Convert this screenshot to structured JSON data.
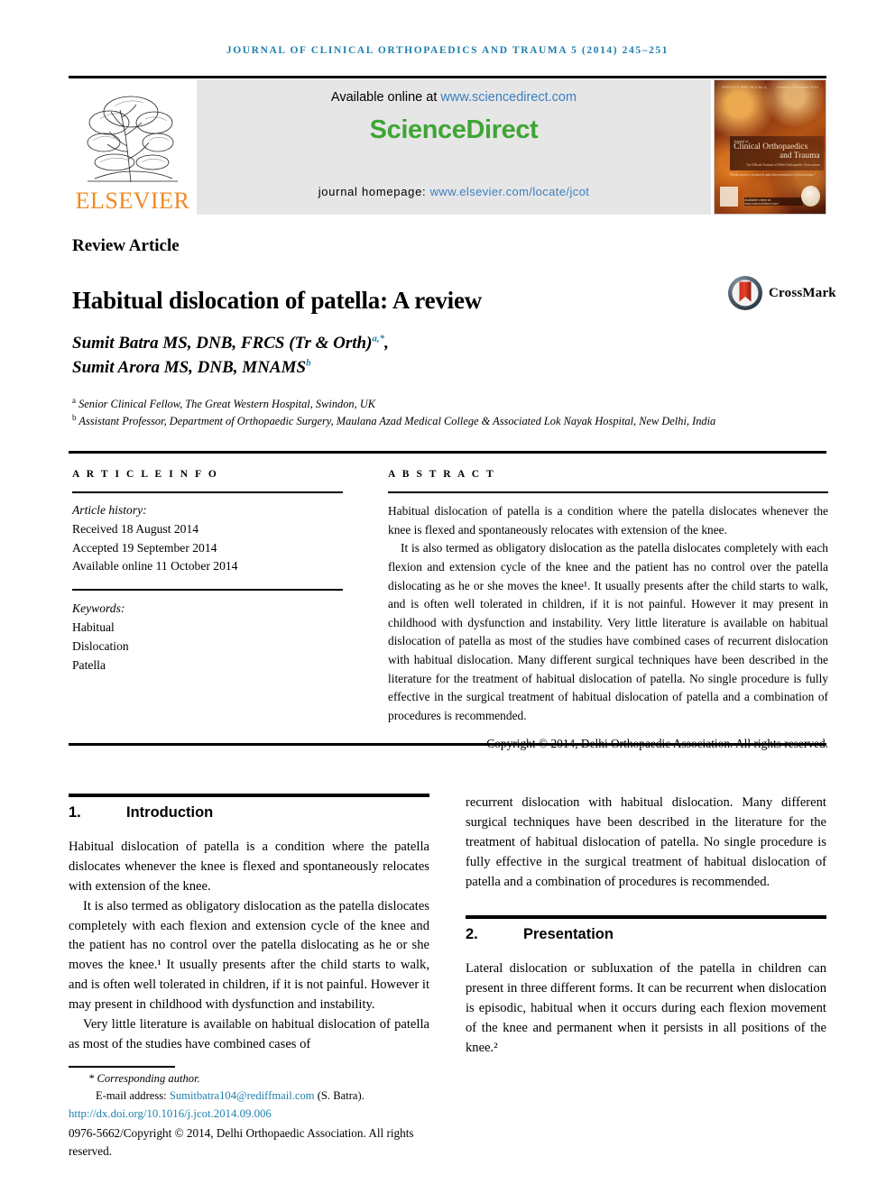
{
  "running_head": "JOURNAL OF CLINICAL ORTHOPAEDICS AND TRAUMA 5 (2014) 245–251",
  "masthead": {
    "publisher_name": "ELSEVIER",
    "available_prefix": "Available online at ",
    "available_url": "www.sciencedirect.com",
    "sciencedirect_science": "Science",
    "sciencedirect_direct": "Direct",
    "homepage_prefix": "journal homepage: ",
    "homepage_url": "www.elsevier.com/locate/jcot",
    "cover": {
      "top_left": "ISSN 0976-5662  Vol 5 No 4",
      "top_right": "October - December 2014",
      "kicker": "Journal of",
      "title_line1": "Clinical Orthopaedics",
      "title_line2": "and Trauma",
      "subtitle": "An Official Journal of Delhi Orthopaedic Association",
      "quote": "“Dedicated to research and dissemination of knowledge”",
      "bottom_bar": "Available online at www.sciencedirect.com"
    }
  },
  "article": {
    "type_label": "Review Article",
    "title": "Habitual dislocation of patella: A review",
    "crossmark_label": "CrossMark",
    "authors": [
      {
        "name": "Sumit Batra MS, DNB, FRCS (Tr & Orth)",
        "marks": "a,*",
        "trailing": ","
      },
      {
        "name": "Sumit Arora MS, DNB, MNAMS",
        "marks": "b",
        "trailing": ""
      }
    ],
    "affiliations": [
      {
        "mark": "a",
        "text": "Senior Clinical Fellow, The Great Western Hospital, Swindon, UK"
      },
      {
        "mark": "b",
        "text": "Assistant Professor, Department of Orthopaedic Surgery, Maulana Azad Medical College & Associated Lok Nayak Hospital, New Delhi, India"
      }
    ]
  },
  "article_info": {
    "label": "A R T I C L E  I N F O",
    "history_header": "Article history:",
    "received": "Received 18 August 2014",
    "accepted": "Accepted 19 September 2014",
    "available_online": "Available online 11 October 2014",
    "keywords_header": "Keywords:",
    "keywords": [
      "Habitual",
      "Dislocation",
      "Patella"
    ]
  },
  "abstract": {
    "label": "A B S T R A C T",
    "paragraphs": [
      "Habitual dislocation of patella is a condition where the patella dislocates whenever the knee is flexed and spontaneously relocates with extension of the knee.",
      "It is also termed as obligatory dislocation as the patella dislocates completely with each flexion and extension cycle of the knee and the patient has no control over the patella dislocating as he or she moves the knee¹. It usually presents after the child starts to walk, and is often well tolerated in children, if it is not painful. However it may present in childhood with dysfunction and instability. Very little literature is available on habitual dislocation of patella as most of the studies have combined cases of recurrent dislocation with habitual dislocation. Many different surgical techniques have been described in the literature for the treatment of habitual dislocation of patella. No single procedure is fully effective in the surgical treatment of habitual dislocation of patella and a combination of procedures is recommended."
    ],
    "copyright": "Copyright © 2014, Delhi Orthopaedic Association. All rights reserved."
  },
  "sections": [
    {
      "number": "1.",
      "title": "Introduction",
      "paragraphs": [
        "Habitual dislocation of patella is a condition where the patella dislocates whenever the knee is flexed and spontaneously relocates with extension of the knee.",
        "It is also termed as obligatory dislocation as the patella dislocates completely with each flexion and extension cycle of the knee and the patient has no control over the patella dislocating as he or she moves the knee.¹ It usually presents after the child starts to walk, and is often well tolerated in children, if it is not painful. However it may present in childhood with dysfunction and instability.",
        "Very little literature is available on habitual dislocation of patella as most of the studies have combined cases of",
        "recurrent dislocation with habitual dislocation. Many different surgical techniques have been described in the literature for the treatment of habitual dislocation of patella. No single procedure is fully effective in the surgical treatment of habitual dislocation of patella and a combination of procedures is recommended."
      ]
    },
    {
      "number": "2.",
      "title": "Presentation",
      "paragraphs": [
        "Lateral dislocation or subluxation of the patella in children can present in three different forms. It can be recurrent when dislocation is episodic, habitual when it occurs during each flexion movement of the knee and permanent when it persists in all positions of the knee.²"
      ]
    }
  ],
  "footer": {
    "corresponding_author": "Corresponding author.",
    "email_label": "E-mail address:",
    "email_address": "Sumitbatra104@rediffmail.com",
    "email_owner": "(S. Batra).",
    "doi": "http://dx.doi.org/10.1016/j.jcot.2014.09.006",
    "issn_line": "0976-5662/Copyright © 2014, Delhi Orthopaedic Association. All rights reserved."
  },
  "colors": {
    "link_blue": "#1f7fad",
    "sciencedirect_green": "#3fa535",
    "elsevier_orange": "#f08a22",
    "banner_gray": "#e6e6e6"
  }
}
